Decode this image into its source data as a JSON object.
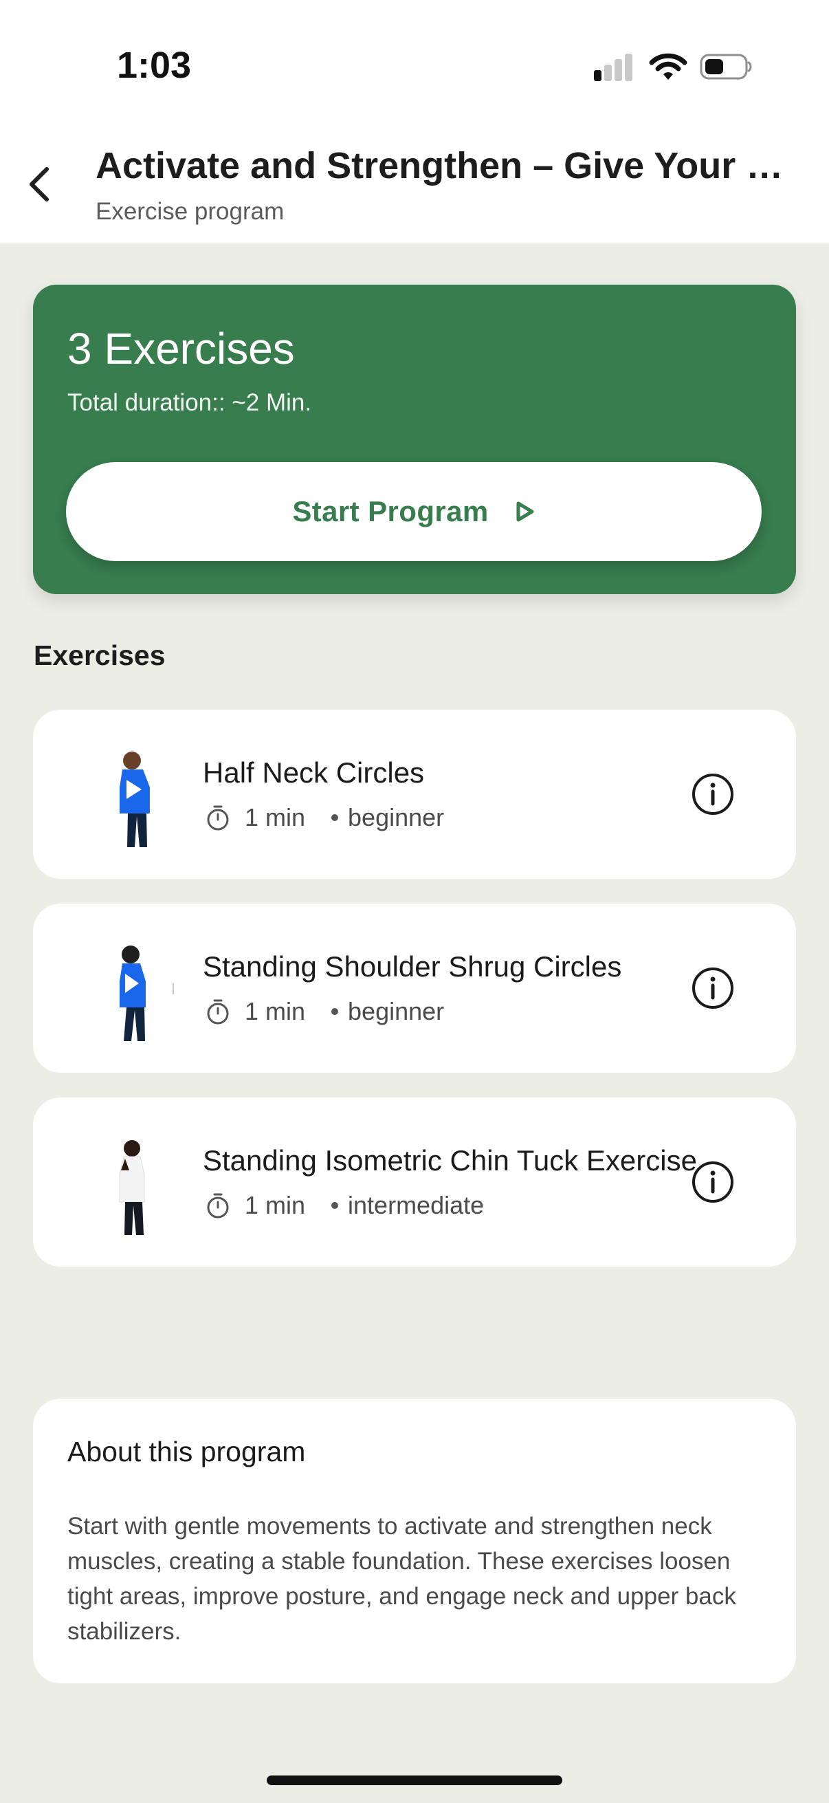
{
  "status_bar": {
    "time": "1:03"
  },
  "header": {
    "title": "Activate and Strengthen – Give Your Neck Stability and Strength",
    "subtitle": "Exercise program"
  },
  "summary": {
    "exercise_count": "3 Exercises",
    "duration": "Total duration:: ~2 Min.",
    "start_label": "Start Program",
    "accent_color": "#377d4d"
  },
  "exercises_section": {
    "label": "Exercises",
    "items": [
      {
        "name": "Half Neck Circles",
        "duration": "1 min",
        "level": "beginner",
        "thumbnail": "person-exercise-thumbnail"
      },
      {
        "name": "Standing Shoulder Shrug Circles",
        "duration": "1 min",
        "level": "beginner",
        "thumbnail": "person-exercise-thumbnail"
      },
      {
        "name": "Standing Isometric Chin Tuck Exercise",
        "duration": "1 min",
        "level": "intermediate",
        "thumbnail": "person-exercise-thumbnail"
      }
    ]
  },
  "about": {
    "title": "About this program",
    "text": "Start with gentle movements to activate and strengthen neck muscles, creating a stable foundation. These exercises loosen tight areas, improve posture, and engage neck and upper back stabilizers."
  },
  "icons": {
    "back": "chevron-left-icon",
    "play": "play-outline-icon",
    "timer": "stopwatch-icon",
    "info": "info-circle-icon"
  }
}
